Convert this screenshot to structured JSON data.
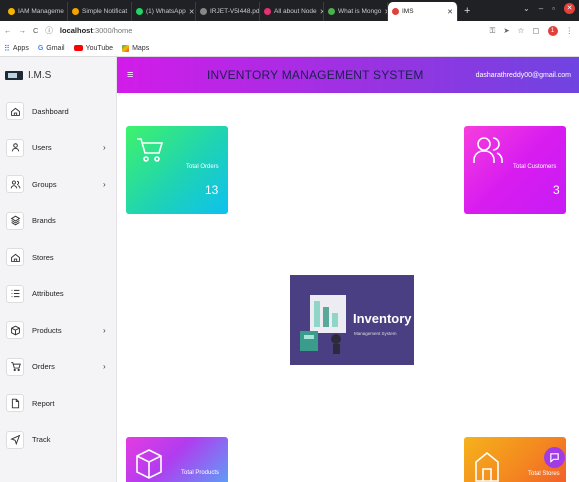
{
  "browser": {
    "tabs": [
      {
        "label": "IAM Manageme",
        "color": "#f4b400"
      },
      {
        "label": "Simple Notificat",
        "color": "#f4a300"
      },
      {
        "label": "(1) WhatsApp",
        "color": "#25d366"
      },
      {
        "label": "IRJET-V5I448.pd",
        "color": "#888888"
      },
      {
        "label": "All about Node",
        "color": "#e53170"
      },
      {
        "label": "What is Mongo",
        "color": "#4caf50"
      },
      {
        "label": "IMS",
        "color": "#e2403a"
      }
    ],
    "new_tab": "+",
    "url_host": "localhost",
    "url_rest": ":3000/home",
    "profile_initial": "1",
    "bookmarks": [
      "Apps",
      "Gmail",
      "YouTube",
      "Maps"
    ]
  },
  "app": {
    "brand": "I.M.S",
    "header_title": "INVENTORY MANAGEMENT SYSTEM",
    "user_email": "dasharathreddy00@gmail.com",
    "nav": [
      {
        "label": "Dashboard",
        "icon": "home-icon",
        "chevron": false
      },
      {
        "label": "Users",
        "icon": "user-icon",
        "chevron": true
      },
      {
        "label": "Groups",
        "icon": "users-icon",
        "chevron": true
      },
      {
        "label": "Brands",
        "icon": "layers-icon",
        "chevron": false
      },
      {
        "label": "Stores",
        "icon": "home-icon",
        "chevron": false
      },
      {
        "label": "Attributes",
        "icon": "list-icon",
        "chevron": false
      },
      {
        "label": "Products",
        "icon": "box-icon",
        "chevron": true
      },
      {
        "label": "Orders",
        "icon": "cart-icon",
        "chevron": true
      },
      {
        "label": "Report",
        "icon": "file-icon",
        "chevron": false
      },
      {
        "label": "Track",
        "icon": "navigation-icon",
        "chevron": false
      }
    ],
    "cards": {
      "orders": {
        "label": "Total Orders",
        "value": "13"
      },
      "customers": {
        "label": "Total Customers",
        "value": "3"
      },
      "products": {
        "label": "Total Products"
      },
      "stores": {
        "label": "Total Stores"
      }
    },
    "hero": {
      "title": "Inventory",
      "subtitle": "Management System"
    },
    "colors": {
      "header_start": "#d21ce9",
      "header_end": "#6f44e0",
      "orders_card": "#1fd3b3",
      "customers_card": "#d81cf0"
    }
  }
}
